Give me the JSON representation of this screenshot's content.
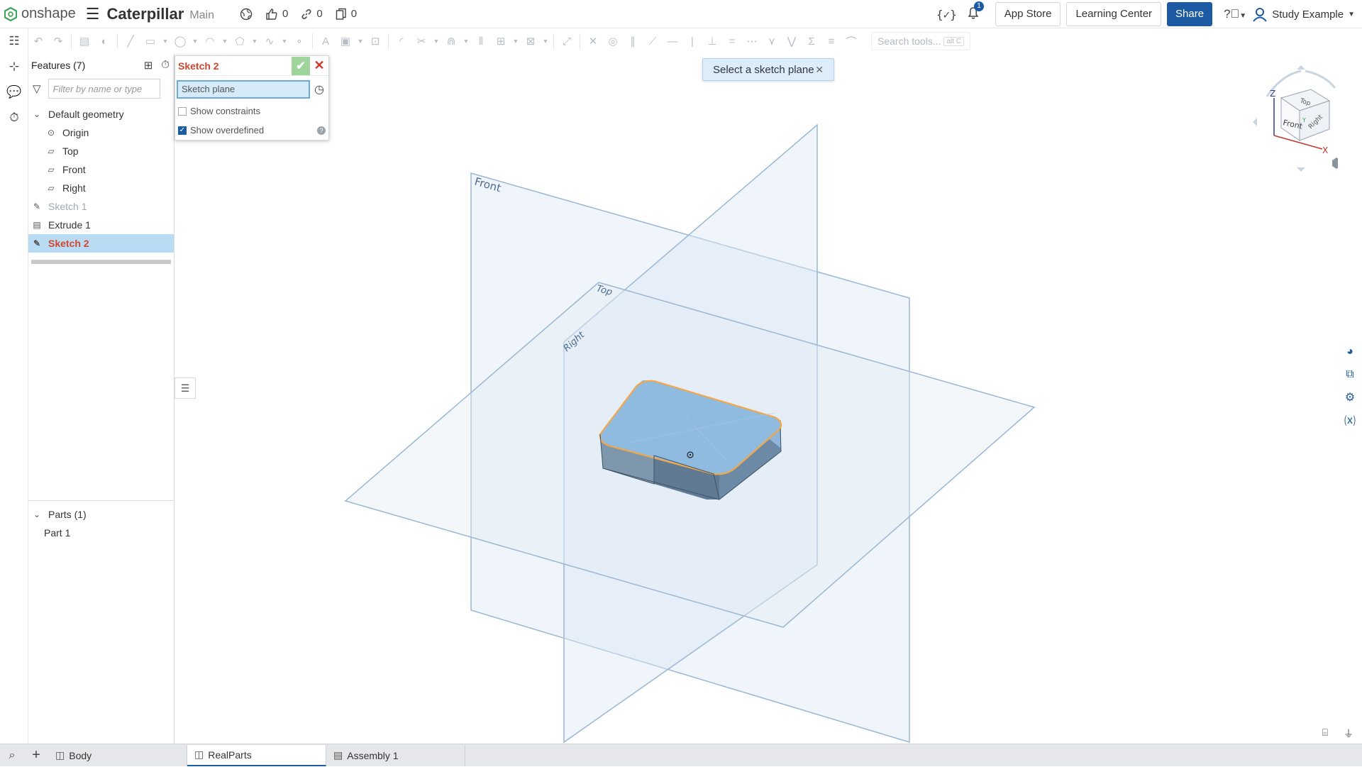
{
  "app": {
    "logo_text": "onshape"
  },
  "document": {
    "title": "Caterpillar",
    "branch": "Main"
  },
  "counts": {
    "likes": "0",
    "links": "0",
    "copies": "0"
  },
  "topright": {
    "notif_count": "1",
    "app_store": "App Store",
    "learning_center": "Learning Center",
    "share": "Share",
    "user": "Study Example"
  },
  "toolbar": {
    "search_placeholder": "Search tools...",
    "search_shortcut": "alt C"
  },
  "features": {
    "title": "Features (7)",
    "filter_placeholder": "Filter by name or type",
    "default_geometry": "Default geometry",
    "items": [
      {
        "label": "Origin"
      },
      {
        "label": "Top"
      },
      {
        "label": "Front"
      },
      {
        "label": "Right"
      }
    ],
    "sketch1": "Sketch 1",
    "extrude1": "Extrude 1",
    "sketch2": "Sketch 2"
  },
  "parts": {
    "title": "Parts (1)",
    "item": "Part 1"
  },
  "dialog": {
    "title": "Sketch 2",
    "plane_value": "Sketch plane",
    "show_constraints": "Show constraints",
    "show_overdefined": "Show overdefined",
    "show_constraints_checked": false,
    "show_overdefined_checked": true
  },
  "toast": {
    "message": "Select a sketch plane"
  },
  "planes": {
    "front": "Front",
    "top": "Top",
    "right": "Right"
  },
  "viewcube": {
    "front": "Front",
    "top": "Top",
    "right": "Right",
    "z": "Z",
    "x": "X",
    "y": "Y"
  },
  "tabs": [
    {
      "label": "Body"
    },
    {
      "label": "RealParts"
    },
    {
      "label": "Assembly 1"
    }
  ],
  "colors": {
    "brand": "#1c5aa3",
    "selection": "#b9dcf4",
    "plane_edge": "#9ab7d4",
    "part_top": "#8db9dc",
    "highlight": "#f2a84a"
  }
}
